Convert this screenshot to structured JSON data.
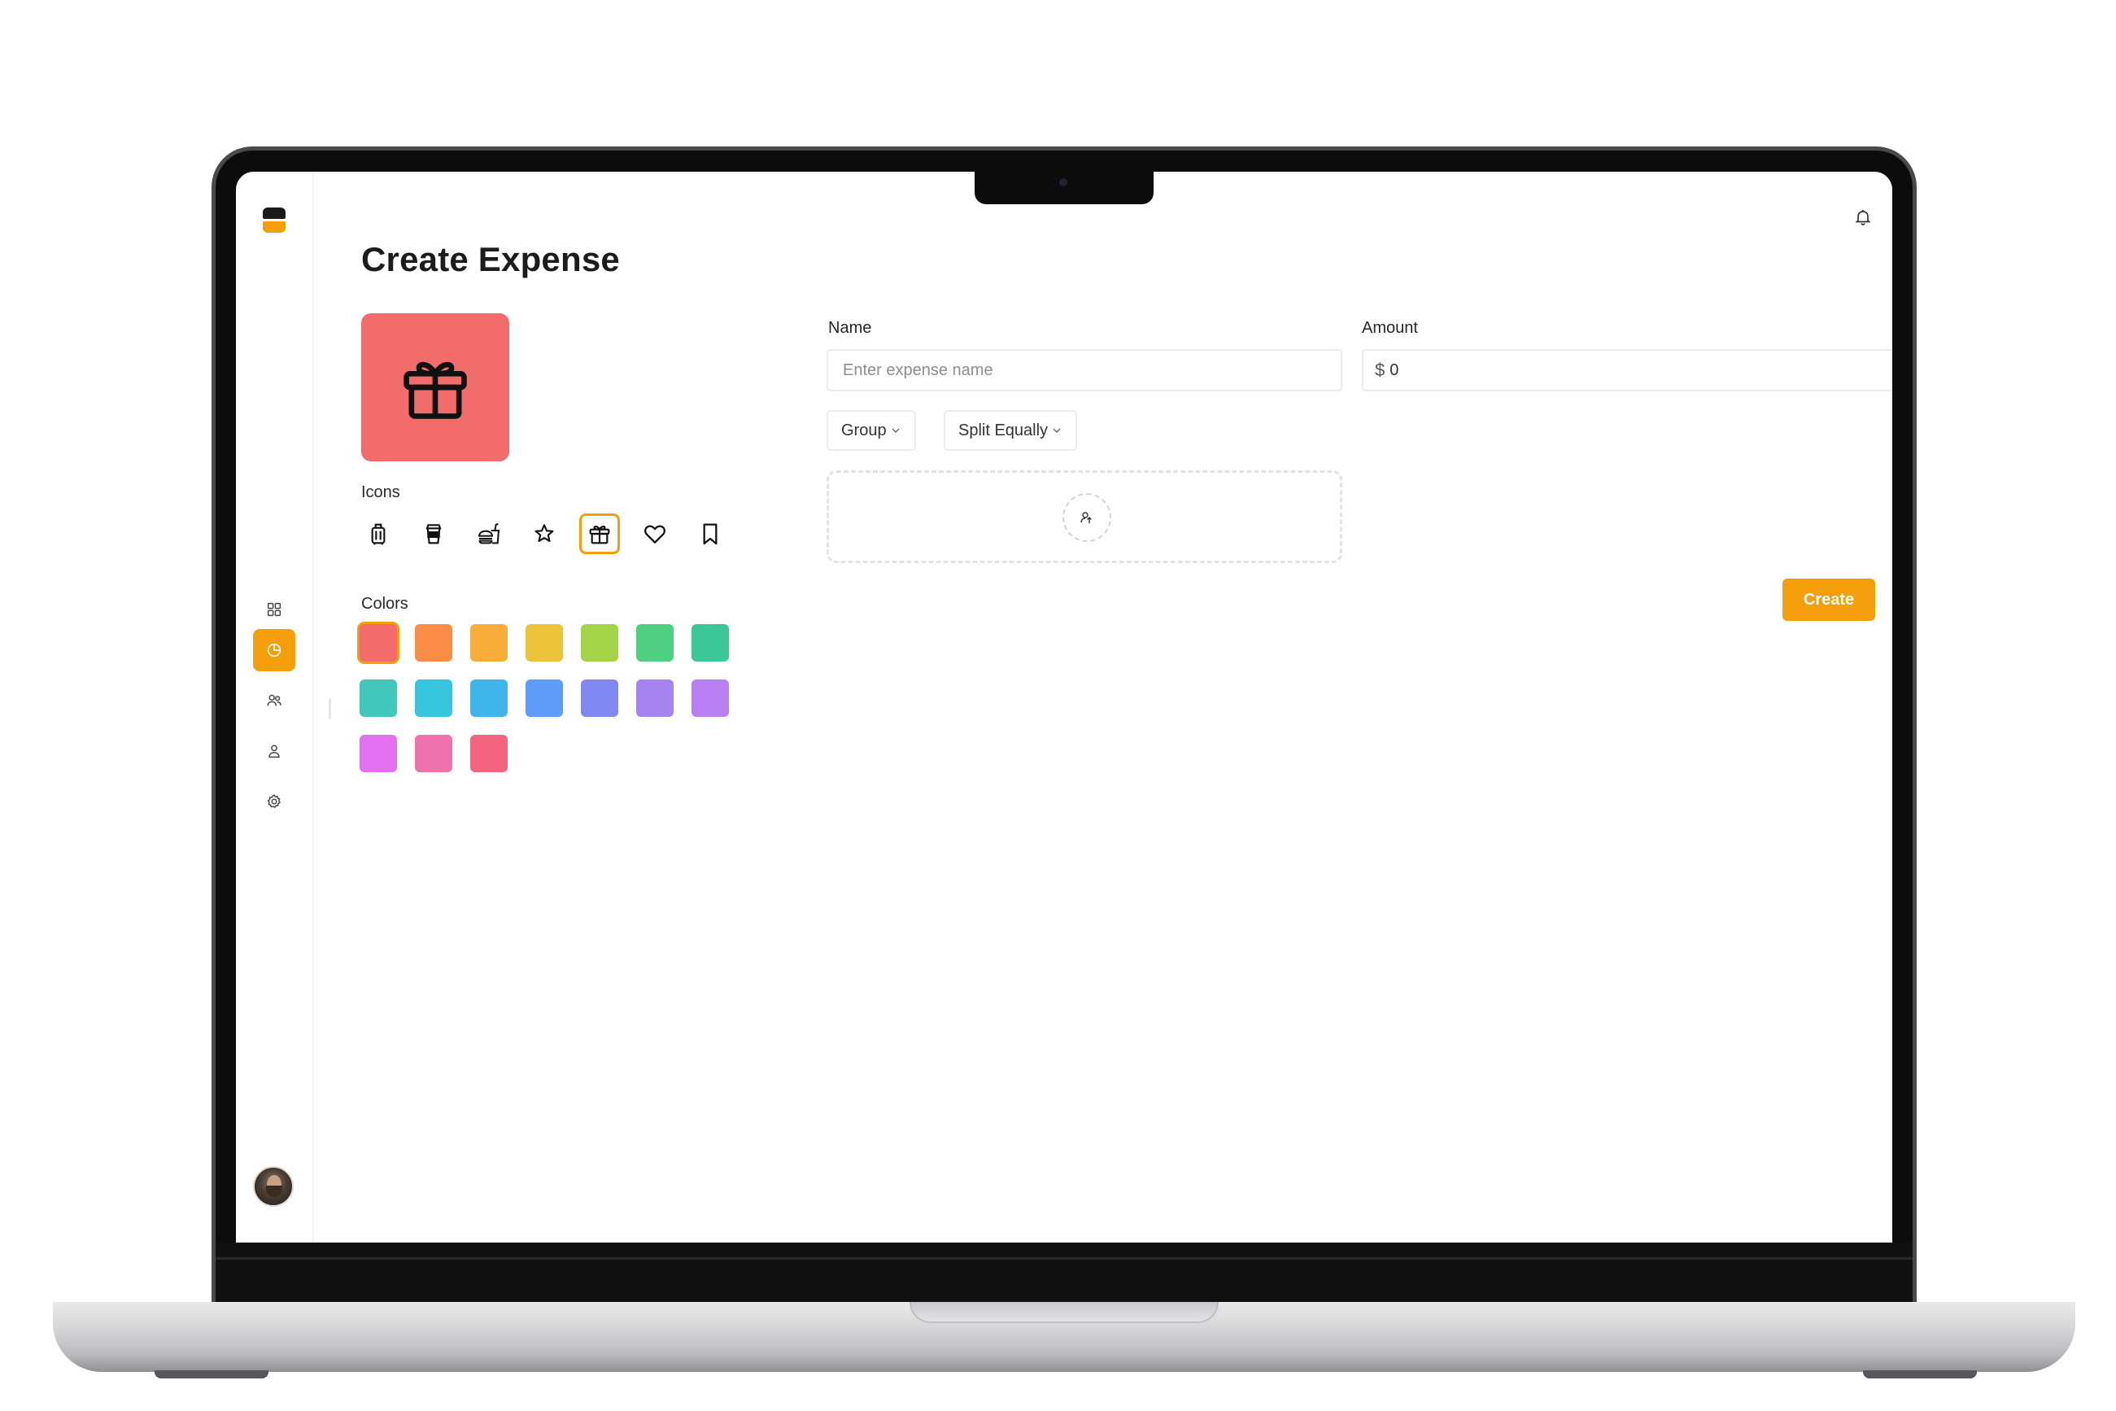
{
  "page": {
    "title": "Create Expense"
  },
  "sidebar": {
    "items": [
      {
        "name": "dashboard",
        "icon": "grid-icon"
      },
      {
        "name": "expenses",
        "icon": "pie-chart-icon",
        "active": true
      },
      {
        "name": "friends",
        "icon": "users-icon"
      },
      {
        "name": "profile",
        "icon": "user-icon"
      },
      {
        "name": "settings",
        "icon": "gear-icon"
      }
    ],
    "accent": "#f59e0b"
  },
  "header": {
    "notification_icon": "bell-icon"
  },
  "editor": {
    "preview_color": "#f16c6b",
    "preview_icon": "gift-icon",
    "icons_label": "Icons",
    "icons": [
      {
        "name": "suitcase-icon"
      },
      {
        "name": "coffee-cup-icon"
      },
      {
        "name": "fast-food-icon"
      },
      {
        "name": "star-icon"
      },
      {
        "name": "gift-icon",
        "selected": true
      },
      {
        "name": "heart-icon"
      },
      {
        "name": "bookmark-icon"
      }
    ],
    "colors_label": "Colors",
    "colors": [
      "#f16c6b",
      "#fb8c45",
      "#f8ad3b",
      "#ecc43a",
      "#a3d448",
      "#4fcf82",
      "#3cc79a",
      "#43c7bb",
      "#35c5de",
      "#3fb5ec",
      "#5d9cf8",
      "#8187f2",
      "#a583f0",
      "#b97ef2",
      "#e271ef",
      "#ef72ac",
      "#f4637f"
    ],
    "selected_color_index": 0
  },
  "form": {
    "name_label": "Name",
    "name_placeholder": "Enter expense name",
    "amount_label": "Amount",
    "currency_symbol": "$",
    "amount_value": "0",
    "group_label": "Group",
    "split_label": "Split Equally",
    "upload_icon": "upload-icon",
    "create_label": "Create"
  }
}
